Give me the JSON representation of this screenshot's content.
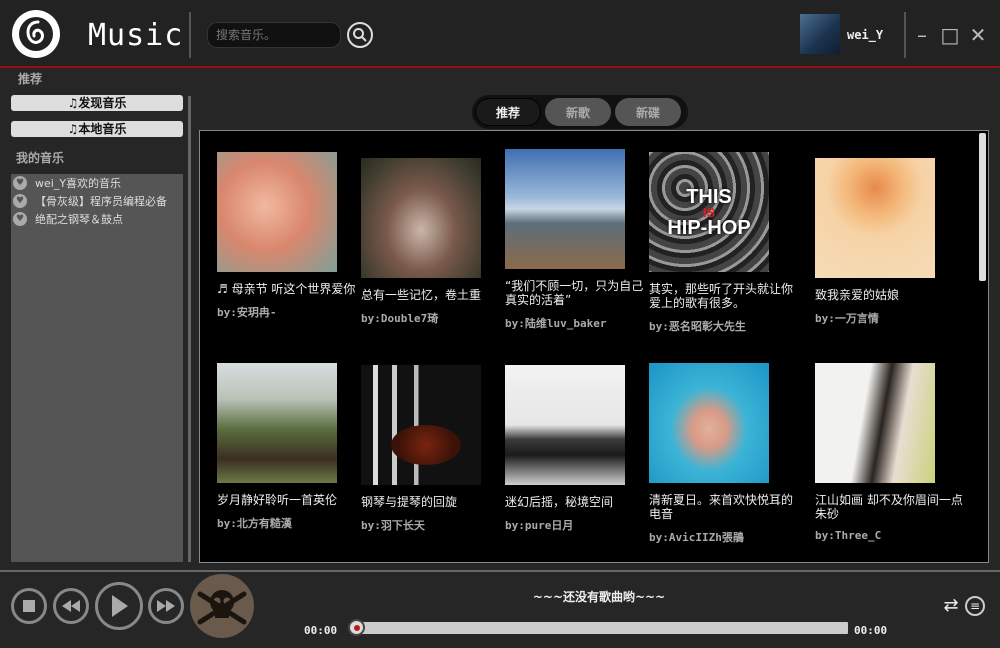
{
  "header": {
    "app_title": "Music",
    "search_placeholder": "搜索音乐。",
    "username": "wei_Y",
    "minimize": "–",
    "maximize": "□",
    "close": "✕"
  },
  "section_label": "推荐",
  "sidebar": {
    "discover": "♫发现音乐",
    "local": "♫本地音乐",
    "my_music_label": "我的音乐",
    "playlists": [
      "wei_Y喜欢的音乐",
      "【骨灰级】程序员编程必备",
      "绝配之钢琴＆鼓点"
    ]
  },
  "tabs": [
    {
      "label": "推荐",
      "active": true
    },
    {
      "label": "新歌",
      "active": false
    },
    {
      "label": "新碟",
      "active": false
    }
  ],
  "cards": [
    {
      "title": "♬ 母亲节 听这个世界爱你",
      "author": "by:安玥冉-"
    },
    {
      "title": "总有一些记忆，卷土重",
      "author": "by:Double7琦"
    },
    {
      "title": "“我们不顾一切，只为自己真实的活着”",
      "author": "by:陆维luv_baker"
    },
    {
      "title": "其实，那些听了开头就让你爱上的歌有很多。",
      "author": "by:恶名昭彰大先生"
    },
    {
      "title": "致我亲爱的姑娘",
      "author": "by:一万言情"
    },
    {
      "title": "岁月静好聆听一首英伦",
      "author": "by:北方有糙漢"
    },
    {
      "title": "钢琴与提琴的回旋",
      "author": "by:羽下长天"
    },
    {
      "title": "迷幻后摇，秘境空间",
      "author": "by:pure日月"
    },
    {
      "title": "清新夏日。来首欢快悦耳的电音",
      "author": "by:AvicIIZh張鵑"
    },
    {
      "title": "江山如画 却不及你眉间一点朱砂",
      "author": "by:Three_C"
    }
  ],
  "cover_texts": {
    "hiphop_line1": "THIS",
    "hiphop_line2": "IS",
    "hiphop_line3": "HIP-HOP"
  },
  "player": {
    "now_playing": "~~~还没有歌曲哟~~~",
    "current_time": "00:00",
    "total_time": "00:00",
    "progress": 0
  }
}
